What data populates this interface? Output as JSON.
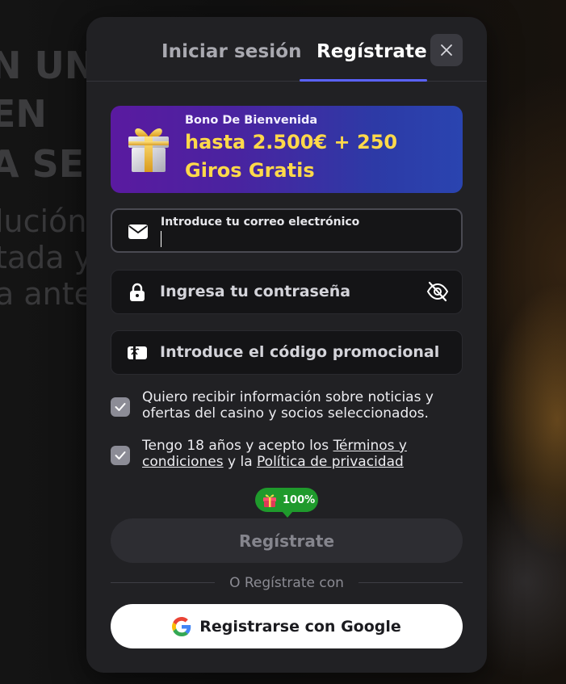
{
  "background": {
    "headline_lines": [
      "N UN",
      "EN",
      "A SE"
    ],
    "sub_lines": [
      "lución",
      "tada y",
      "a ante"
    ]
  },
  "tabs": {
    "login_label": "Iniciar sesión",
    "register_label": "Regístrate",
    "active": "register"
  },
  "bonus": {
    "small_label": "Bono De Bienvenida",
    "main_text": "hasta 2.500€ + 250 Giros Gratis",
    "gift_icon": "gift-icon"
  },
  "form": {
    "email": {
      "label": "Introduce tu correo electrónico",
      "value": "",
      "icon": "envelope-icon"
    },
    "password": {
      "placeholder": "Ingresa tu contraseña",
      "icon": "lock-icon",
      "toggle_icon": "eye-slash-icon"
    },
    "promo": {
      "placeholder": "Introduce el código promocional",
      "icon": "gift-card-icon"
    },
    "consent_news": {
      "checked": true,
      "text": "Quiero recibir información sobre noticias y ofertas del casino y socios seleccionados."
    },
    "consent_terms": {
      "checked": true,
      "prefix": "Tengo 18 años y acepto los ",
      "terms_link": "Términos y condiciones",
      "middle": " y la ",
      "privacy_link": "Política de privacidad"
    },
    "progress": {
      "value_text": "100%",
      "value": 1.0,
      "icon": "gift-icon"
    },
    "submit_label": "Regístrate",
    "divider_text": "O Regístrate con",
    "google_label": "Registrarse con Google"
  },
  "colors": {
    "accent": "#5a62ff",
    "bonus_text": "#ffd94a",
    "progress_green": "#1f9a2c",
    "modal_bg": "#212124"
  }
}
